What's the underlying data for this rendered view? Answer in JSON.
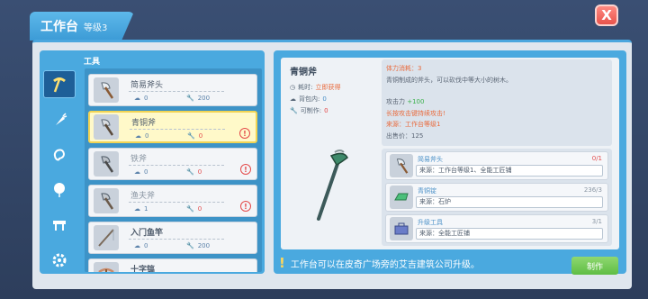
{
  "header": {
    "title": "工作台",
    "level": "等级3",
    "close_label": "X"
  },
  "categories": [
    {
      "name": "pickaxe-icon",
      "active": true
    },
    {
      "name": "carrot-icon",
      "active": false
    },
    {
      "name": "ear-icon",
      "active": false
    },
    {
      "name": "balloon-icon",
      "active": false
    },
    {
      "name": "bench-icon",
      "active": false
    },
    {
      "name": "gear-icon",
      "active": false
    }
  ],
  "list": {
    "section_label": "工具",
    "items": [
      {
        "name": "简易斧头",
        "bag": "0",
        "craft": "200",
        "craft_red": false,
        "warn": false,
        "selected": false,
        "icon": "axe-icon"
      },
      {
        "name": "青铜斧",
        "bag": "0",
        "craft": "0",
        "craft_red": true,
        "warn": true,
        "selected": true,
        "icon": "axe-icon"
      },
      {
        "name": "铁斧",
        "bag": "0",
        "craft": "0",
        "craft_red": true,
        "warn": true,
        "selected": false,
        "icon": "axe-icon"
      },
      {
        "name": "渔夫斧",
        "bag": "1",
        "craft": "0",
        "craft_red": true,
        "warn": true,
        "selected": false,
        "icon": "axe-icon"
      },
      {
        "name": "入门鱼竿",
        "bag": "0",
        "craft": "200",
        "craft_red": false,
        "warn": false,
        "selected": false,
        "icon": "fishing-rod-icon"
      },
      {
        "name": "十字镐",
        "bag": "",
        "craft": "",
        "craft_red": false,
        "warn": false,
        "selected": false,
        "icon": "pickaxe-icon"
      }
    ]
  },
  "detail": {
    "name": "青铜斧",
    "time_label": "耗时:",
    "time_value": "立即获得",
    "bag_label": "背包内:",
    "bag_value": "0",
    "craftable_label": "可制作:",
    "craftable_value": "0",
    "stamina": "体力消耗：3",
    "desc": "青铜制成的斧头，可以砍伐中等大小的树木。",
    "attack_label": "攻击力",
    "attack_value": "+100",
    "long_press": "长按攻击键持续攻击!",
    "source": "来源：工作台等级1",
    "price": "出售价：125"
  },
  "materials": [
    {
      "name": "简易斧头",
      "count": "0/1",
      "count_red": true,
      "source": "来源：工作台等级1、全能工匠铺",
      "icon": "axe-icon"
    },
    {
      "name": "青铜锭",
      "count": "236/3",
      "count_red": false,
      "source": "来源：石炉",
      "icon": "ingot-icon"
    },
    {
      "name": "升级工具",
      "count": "3/1",
      "count_red": false,
      "source": "来源：全能工匠铺",
      "icon": "toolbox-icon"
    }
  ],
  "footer": {
    "tip": "工作台可以在皮奇广场旁的艾吉建筑公司升级。",
    "make_label": "制作"
  }
}
